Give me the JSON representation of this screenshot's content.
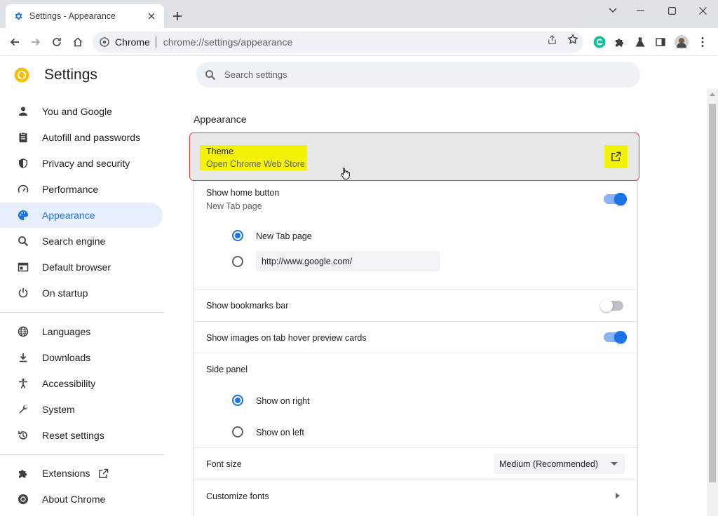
{
  "tab": {
    "title": "Settings - Appearance",
    "icon": "gear-icon"
  },
  "omnibox": {
    "site": "Chrome",
    "url": "chrome://settings/appearance"
  },
  "sidebar": {
    "title": "Settings",
    "items": [
      {
        "label": "You and Google",
        "icon": "person-icon"
      },
      {
        "label": "Autofill and passwords",
        "icon": "clipboard-icon"
      },
      {
        "label": "Privacy and security",
        "icon": "shield-icon"
      },
      {
        "label": "Performance",
        "icon": "speedometer-icon"
      },
      {
        "label": "Appearance",
        "icon": "palette-icon",
        "active": true
      },
      {
        "label": "Search engine",
        "icon": "search-icon"
      },
      {
        "label": "Default browser",
        "icon": "browser-icon"
      },
      {
        "label": "On startup",
        "icon": "power-icon"
      },
      {
        "label": "Languages",
        "icon": "globe-icon"
      },
      {
        "label": "Downloads",
        "icon": "download-icon"
      },
      {
        "label": "Accessibility",
        "icon": "accessibility-icon"
      },
      {
        "label": "System",
        "icon": "wrench-icon"
      },
      {
        "label": "Reset settings",
        "icon": "reset-icon"
      },
      {
        "label": "Extensions",
        "icon": "puzzle-icon"
      },
      {
        "label": "About Chrome",
        "icon": "chrome-icon"
      }
    ]
  },
  "search": {
    "placeholder": "Search settings"
  },
  "appearance": {
    "section_title": "Appearance",
    "theme": {
      "title": "Theme",
      "subtitle": "Open Chrome Web Store"
    },
    "home_button": {
      "label": "Show home button",
      "sublabel": "New Tab page",
      "enabled": true,
      "options": [
        {
          "label": "New Tab page",
          "checked": true
        },
        {
          "value": "http://www.google.com/",
          "checked": false
        }
      ]
    },
    "bookmarks_bar": {
      "label": "Show bookmarks bar",
      "enabled": false
    },
    "tab_hover": {
      "label": "Show images on tab hover preview cards",
      "enabled": true
    },
    "side_panel": {
      "label": "Side panel",
      "options": [
        {
          "label": "Show on right",
          "checked": true
        },
        {
          "label": "Show on left",
          "checked": false
        }
      ]
    },
    "font_size": {
      "label": "Font size",
      "value": "Medium (Recommended)"
    },
    "customize_fonts": {
      "label": "Customize fonts"
    }
  },
  "colors": {
    "accent": "#1a73e8",
    "highlight": "#f4f206",
    "outline": "#e53935"
  }
}
